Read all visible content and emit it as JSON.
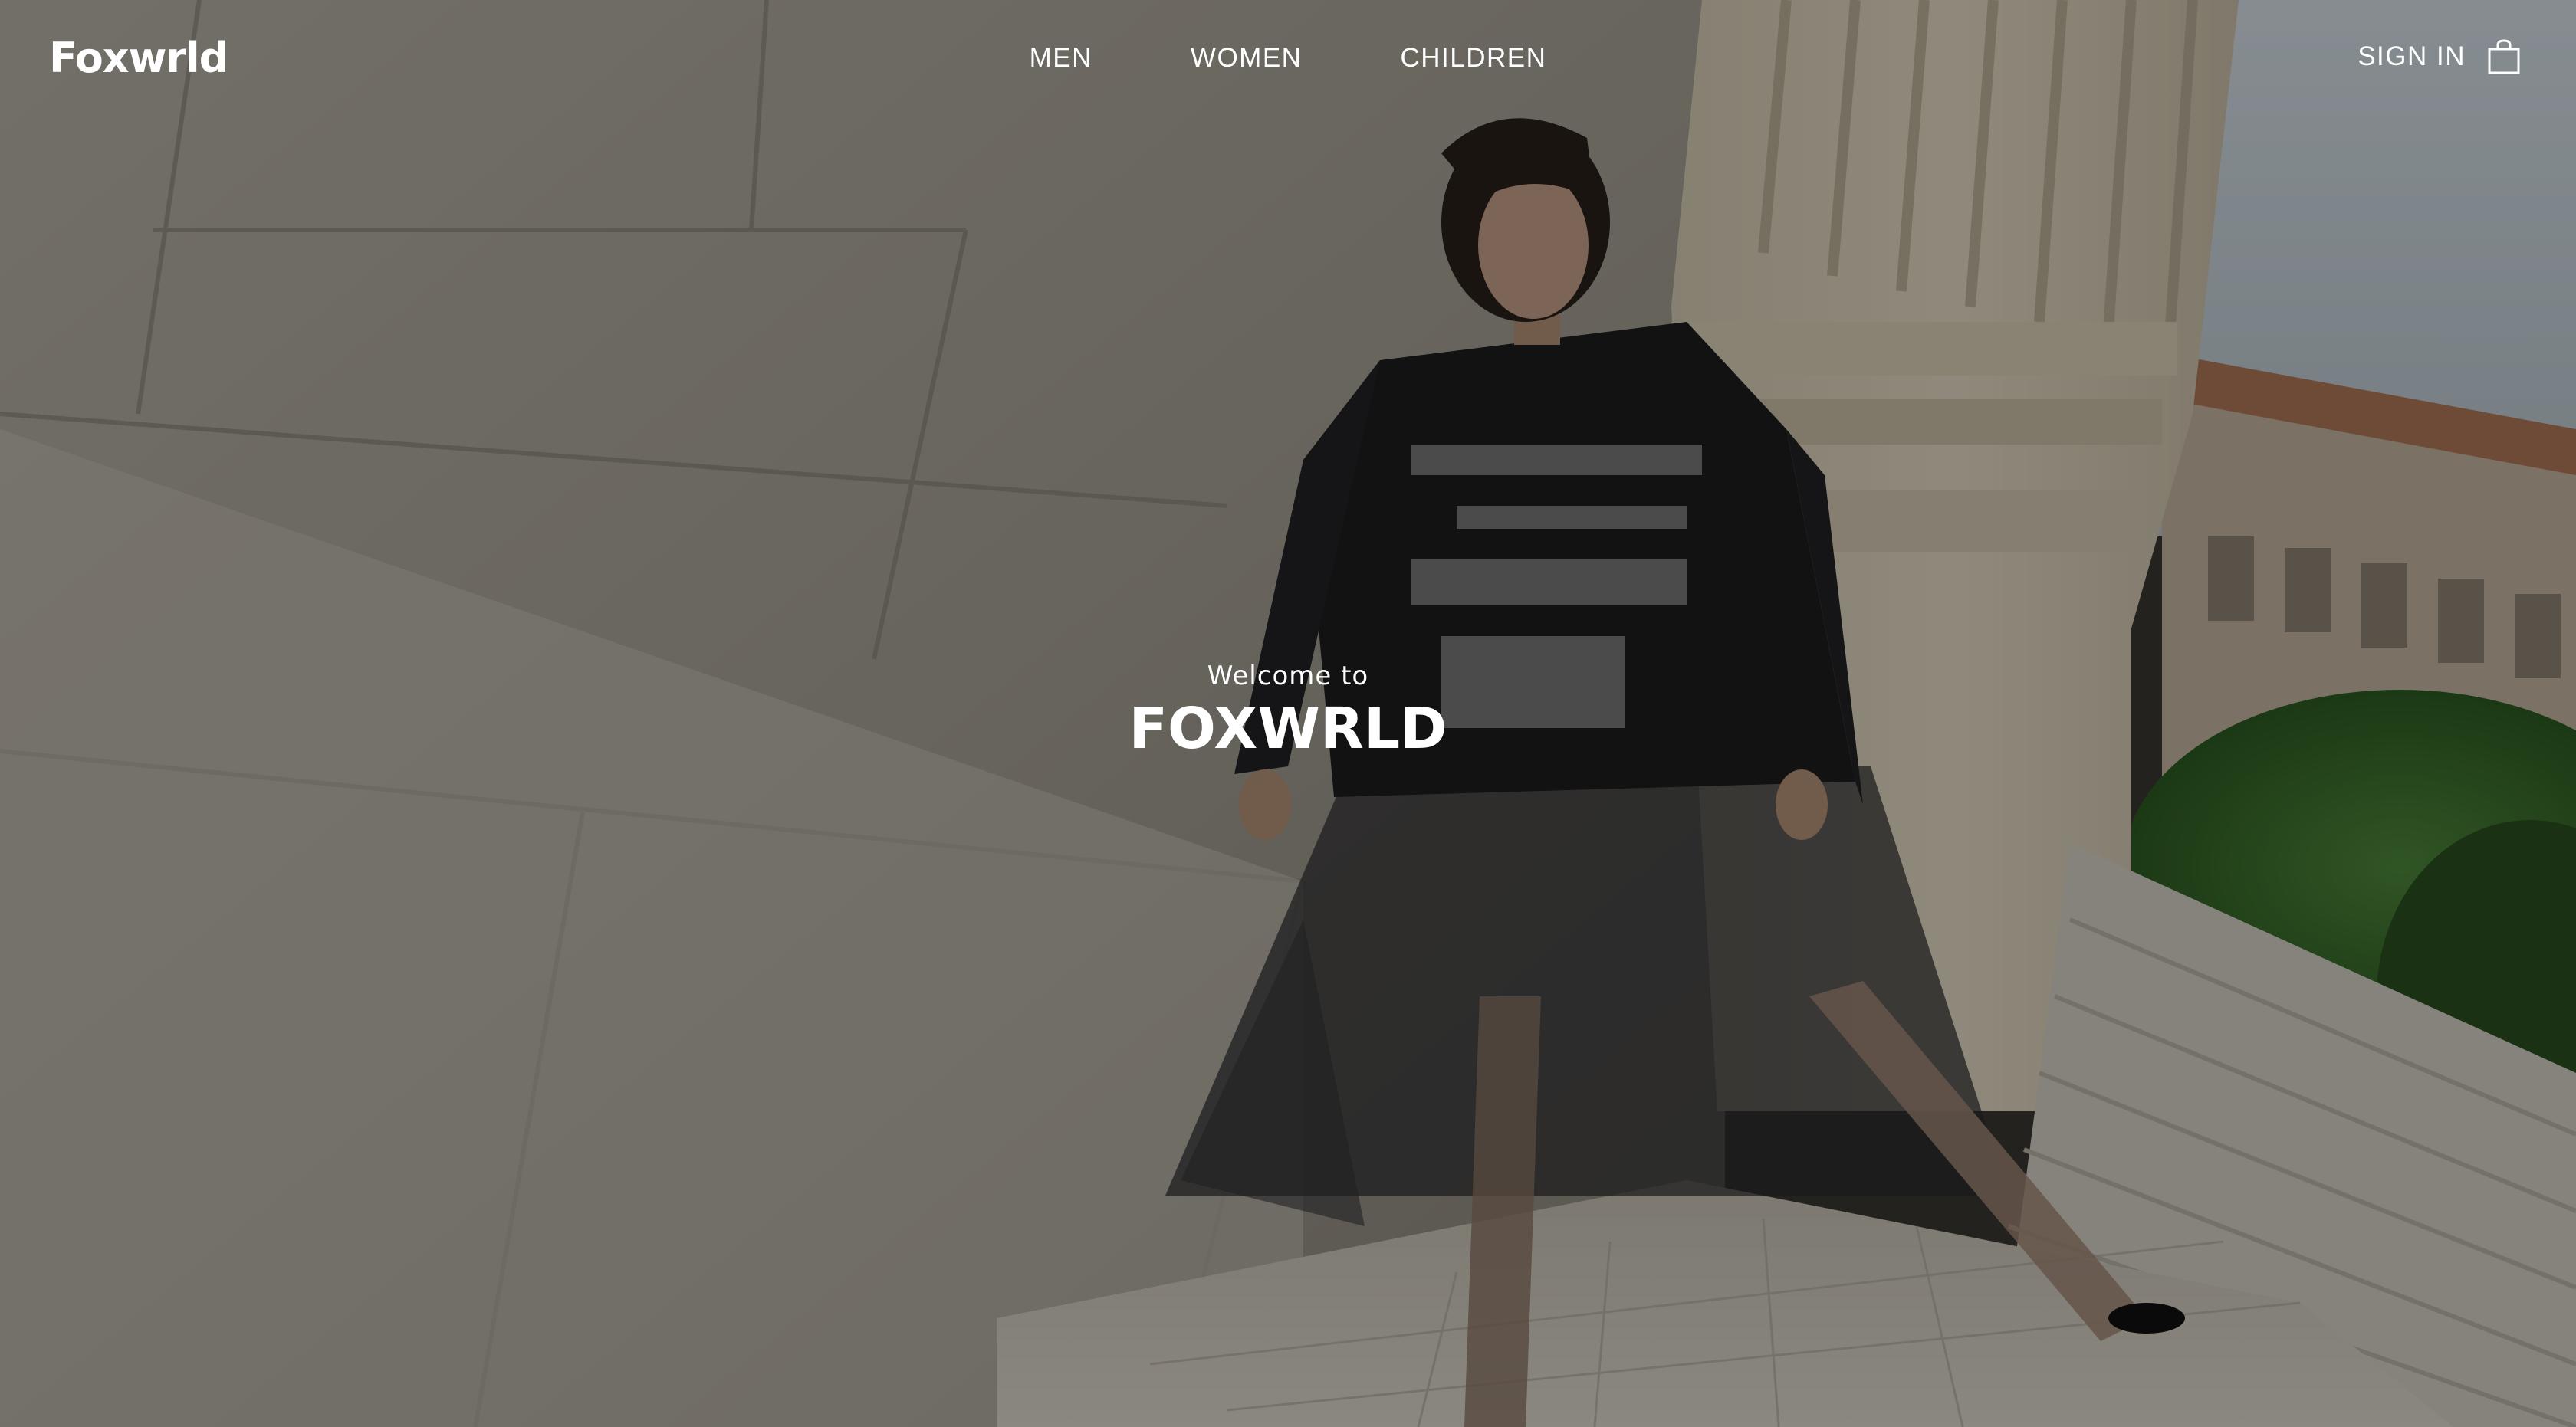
{
  "brand": {
    "logo_text": "Foxwrld"
  },
  "nav": {
    "items": [
      {
        "label": "MEN"
      },
      {
        "label": "WOMEN"
      },
      {
        "label": "CHILDREN"
      }
    ],
    "sign_in_label": "SIGN IN",
    "cart_icon": "shopping-bag-icon"
  },
  "hero": {
    "welcome_line": "Welcome to",
    "headline": "FOXWRLD",
    "media": "fashion-video-background"
  },
  "colors": {
    "text": "#ffffff",
    "overlay": "rgba(0,0,0,0.38)"
  }
}
